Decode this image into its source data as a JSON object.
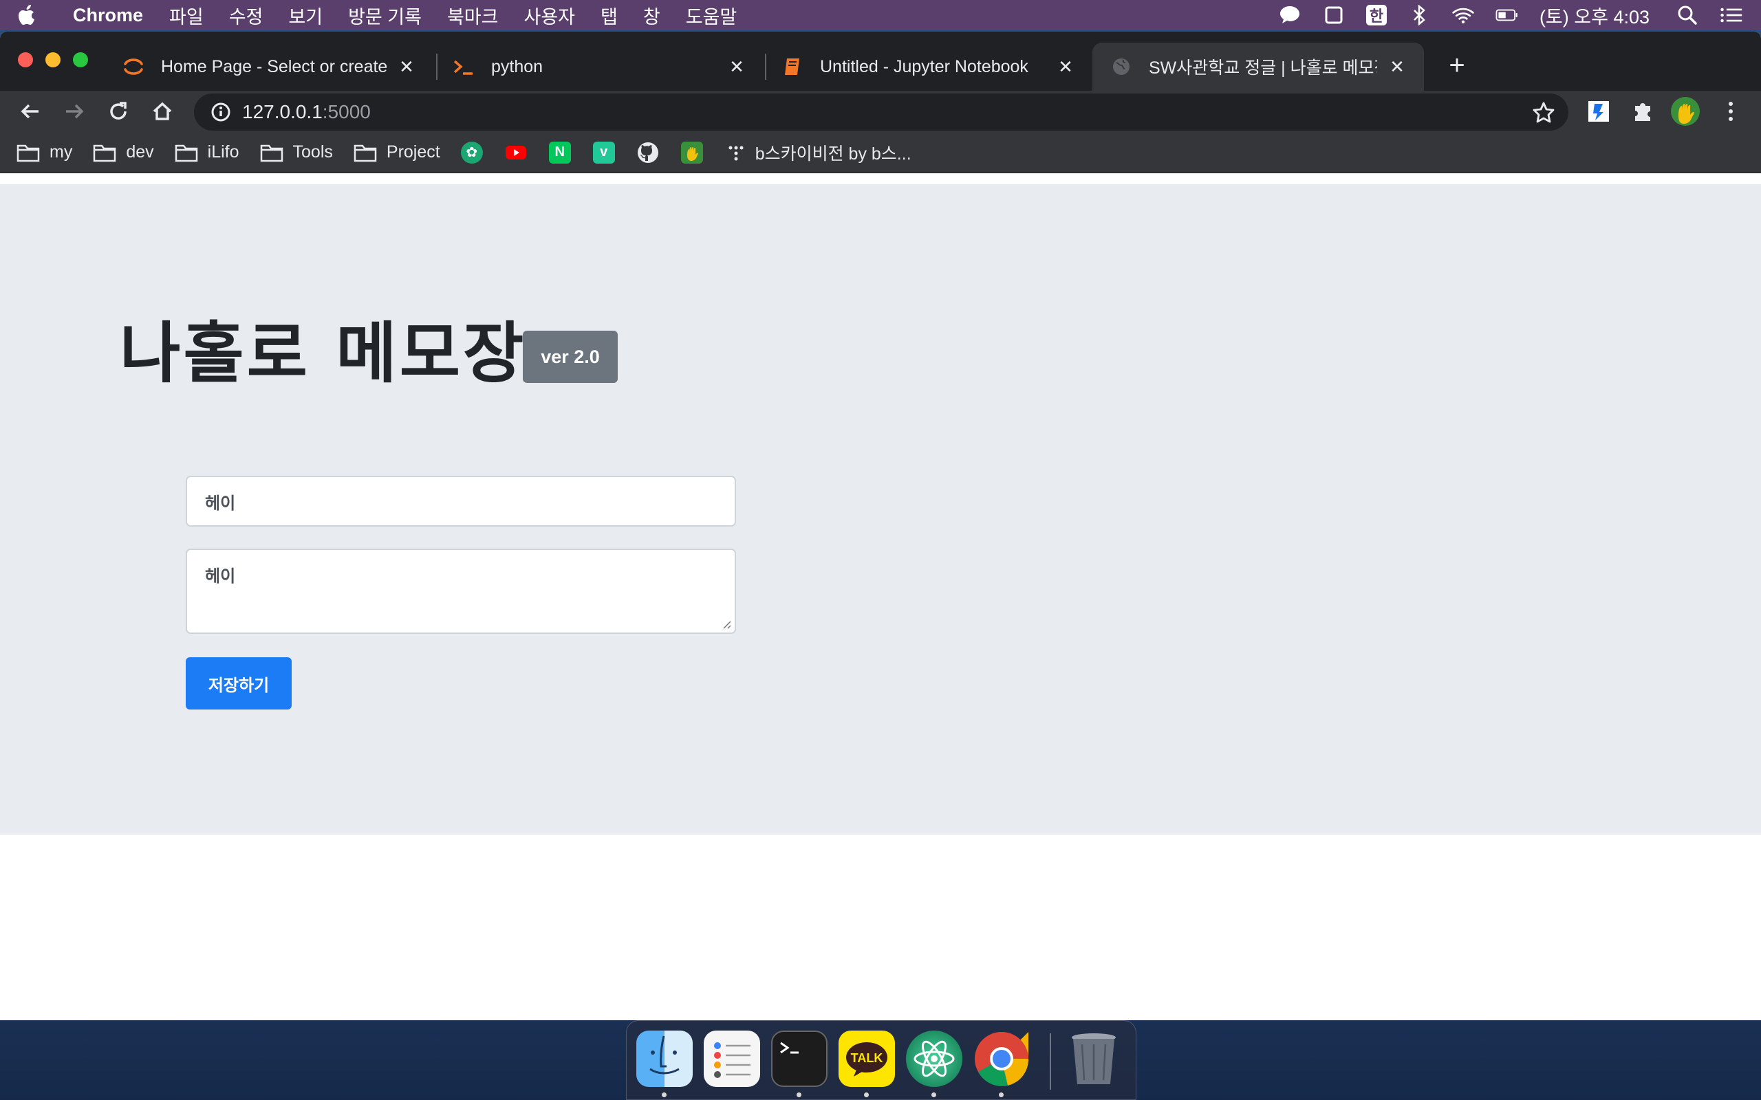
{
  "menubar": {
    "app_name": "Chrome",
    "items": [
      "파일",
      "수정",
      "보기",
      "방문 기록",
      "북마크",
      "사용자",
      "탭",
      "창",
      "도움말"
    ],
    "ime": "한",
    "clock": "(토) 오후 4:03"
  },
  "tabs": [
    {
      "title": "Home Page - Select or create a",
      "icon": "jupyter-icon"
    },
    {
      "title": "python",
      "icon": "terminal-icon"
    },
    {
      "title": "Untitled - Jupyter Notebook",
      "icon": "notebook-icon"
    },
    {
      "title": "SW사관학교 정글 | 나홀로 메모장",
      "icon": "globe-icon"
    }
  ],
  "address": {
    "host": "127.0.0.1",
    "port": ":5000"
  },
  "bookmarks": {
    "folders": [
      "my",
      "dev",
      "iLifo",
      "Tools",
      "Project"
    ],
    "last": "b스카이비전 by b스..."
  },
  "page": {
    "title": "나홀로 메모장",
    "version": "ver 2.0",
    "title_input_value": "헤이",
    "content_value": "헤이",
    "save_label": "저장하기"
  },
  "colors": {
    "menubar": "#5a3f6c",
    "page_bg": "#e8ebef",
    "badge": "#6c757d",
    "primary": "#1b7cf5"
  }
}
